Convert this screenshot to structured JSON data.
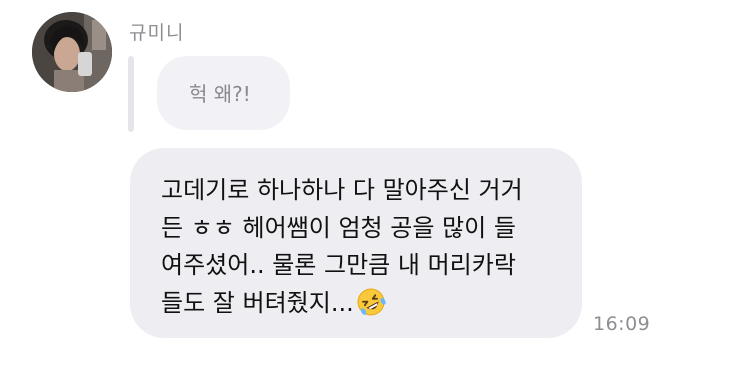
{
  "message": {
    "sender_name": "규미니",
    "quoted_text": "헉 왜?!",
    "lines": [
      "고데기로 하나하나 다 말아주신 거거",
      "든 ㅎㅎ 헤어쌤이 엄청 공을 많이 들",
      "여주셨어.. 물론 그만큼 내 머리카락",
      "들도 잘 버텨줬지..."
    ],
    "trailing_emoji": "rolling-on-the-floor-laughing-emoji",
    "timestamp": "16:09"
  },
  "colors": {
    "bubble_background": "#eeeef2",
    "quoted_bubble_background": "#f2f2f6",
    "quote_bar": "#e6e6ea",
    "secondary_text": "#8e8e93",
    "primary_text": "#111111"
  }
}
